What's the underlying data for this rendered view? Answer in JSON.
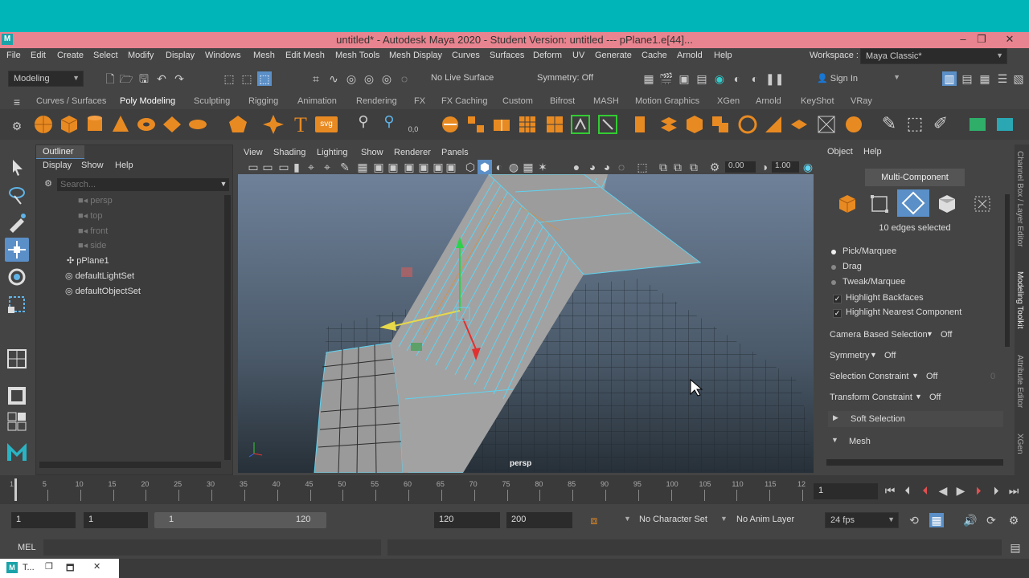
{
  "window": {
    "title": "untitled* - Autodesk Maya 2020 - Student Version: untitled  ---  pPlane1.e[44]...",
    "logo": "M",
    "controls": [
      "–",
      "❐",
      "✕"
    ]
  },
  "menubar": {
    "items": [
      "File",
      "Edit",
      "Create",
      "Select",
      "Modify",
      "Display",
      "Windows",
      "Mesh",
      "Edit Mesh",
      "Mesh Tools",
      "Mesh Display",
      "Curves",
      "Surfaces",
      "Deform",
      "UV",
      "Generate",
      "Cache",
      "Arnold",
      "Help"
    ],
    "workspace_label": "Workspace :",
    "workspace_value": "Maya Classic*"
  },
  "toolbar": {
    "menuset": "Modeling",
    "live_surface": "No Live Surface",
    "symmetry": "Symmetry: Off",
    "sign_in": "Sign In"
  },
  "shelf": {
    "tabs": [
      "Curves / Surfaces",
      "Poly Modeling",
      "Sculpting",
      "Rigging",
      "Animation",
      "Rendering",
      "FX",
      "FX Caching",
      "Custom",
      "Bifrost",
      "MASH",
      "Motion Graphics",
      "XGen",
      "Arnold",
      "KeyShot",
      "VRay"
    ],
    "active_tab": "Poly Modeling",
    "svg_label": "svg",
    "text_label": "T",
    "num_label": "0,0"
  },
  "outliner": {
    "title": "Outliner",
    "menu": [
      "Display",
      "Show",
      "Help"
    ],
    "search_placeholder": "Search...",
    "items": [
      {
        "label": "persp",
        "dim": true
      },
      {
        "label": "top",
        "dim": true
      },
      {
        "label": "front",
        "dim": true
      },
      {
        "label": "side",
        "dim": true
      },
      {
        "label": "pPlane1",
        "dim": false
      },
      {
        "label": "defaultLightSet",
        "dim": false
      },
      {
        "label": "defaultObjectSet",
        "dim": false
      }
    ]
  },
  "viewport": {
    "menu": [
      "View",
      "Shading",
      "Lighting",
      "Show",
      "Renderer",
      "Panels"
    ],
    "field_a": "0.00",
    "field_b": "1.00",
    "camera_label": "persp"
  },
  "rightpanel": {
    "menu": [
      "Object",
      "Help"
    ],
    "mode_title": "Multi-Component",
    "selection_info": "10 edges selected",
    "pick_modes": [
      {
        "label": "Pick/Marquee",
        "selected": true
      },
      {
        "label": "Drag",
        "selected": false
      },
      {
        "label": "Tweak/Marquee",
        "selected": false
      }
    ],
    "checks": [
      "Highlight Backfaces",
      "Highlight Nearest Component"
    ],
    "props": [
      {
        "label": "Camera Based Selection",
        "value": "Off"
      },
      {
        "label": "Symmetry",
        "value": "Off"
      },
      {
        "label": "Selection Constraint",
        "value": "Off"
      },
      {
        "label": "Transform Constraint",
        "value": "Off"
      }
    ],
    "constraint_num": "0",
    "sections": [
      "Soft Selection",
      "Mesh"
    ],
    "vertical_tabs": [
      "Channel Box / Layer Editor",
      "Modeling Toolkit",
      "Attribute Editor",
      "XGen"
    ]
  },
  "timeline": {
    "ticks": [
      "1",
      "5",
      "10",
      "15",
      "20",
      "25",
      "30",
      "35",
      "40",
      "45",
      "50",
      "55",
      "60",
      "65",
      "70",
      "75",
      "80",
      "85",
      "90",
      "95",
      "100",
      "105",
      "110",
      "115",
      "12"
    ],
    "current_frame": "1"
  },
  "range": {
    "start": "1",
    "anim_start": "1",
    "slider_start": "1",
    "slider_end": "120",
    "anim_end": "120",
    "end": "200",
    "character_set": "No Character Set",
    "anim_layer": "No Anim Layer",
    "fps": "24 fps"
  },
  "mel": {
    "label": "MEL"
  },
  "taskbar": {
    "item": "T...",
    "controls": [
      "❐",
      "🗖",
      "✕"
    ]
  },
  "colors": {
    "title_bg": "#e8848f",
    "accent": "#5b8fc7",
    "selection_cyan": "#5fd3f0",
    "shelf_orange": "#e88a22"
  }
}
